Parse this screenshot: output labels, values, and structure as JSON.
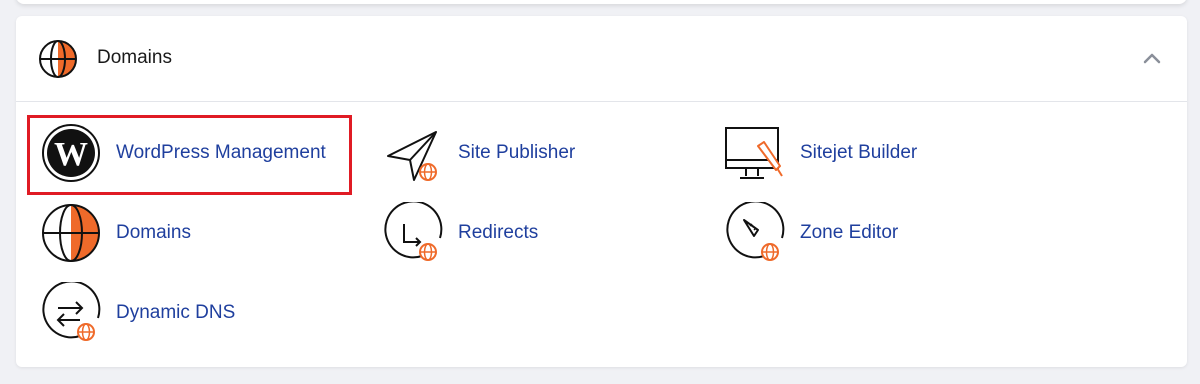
{
  "section": {
    "title": "Domains",
    "icon": "globe-icon",
    "collapse_icon": "chevron-up-icon"
  },
  "items": [
    {
      "label": "WordPress Management",
      "icon": "wordpress-icon",
      "highlighted": true
    },
    {
      "label": "Site Publisher",
      "icon": "paper-plane-globe-icon"
    },
    {
      "label": "Sitejet Builder",
      "icon": "monitor-pencil-icon"
    },
    {
      "label": "Domains",
      "icon": "globe-icon"
    },
    {
      "label": "Redirects",
      "icon": "redirect-arrow-globe-icon"
    },
    {
      "label": "Zone Editor",
      "icon": "rocket-globe-icon"
    },
    {
      "label": "Dynamic DNS",
      "icon": "swap-arrows-globe-icon"
    }
  ],
  "colors": {
    "link": "#1f3f9e",
    "accent_orange": "#ef6a2a",
    "highlight_border": "#e01b24"
  }
}
